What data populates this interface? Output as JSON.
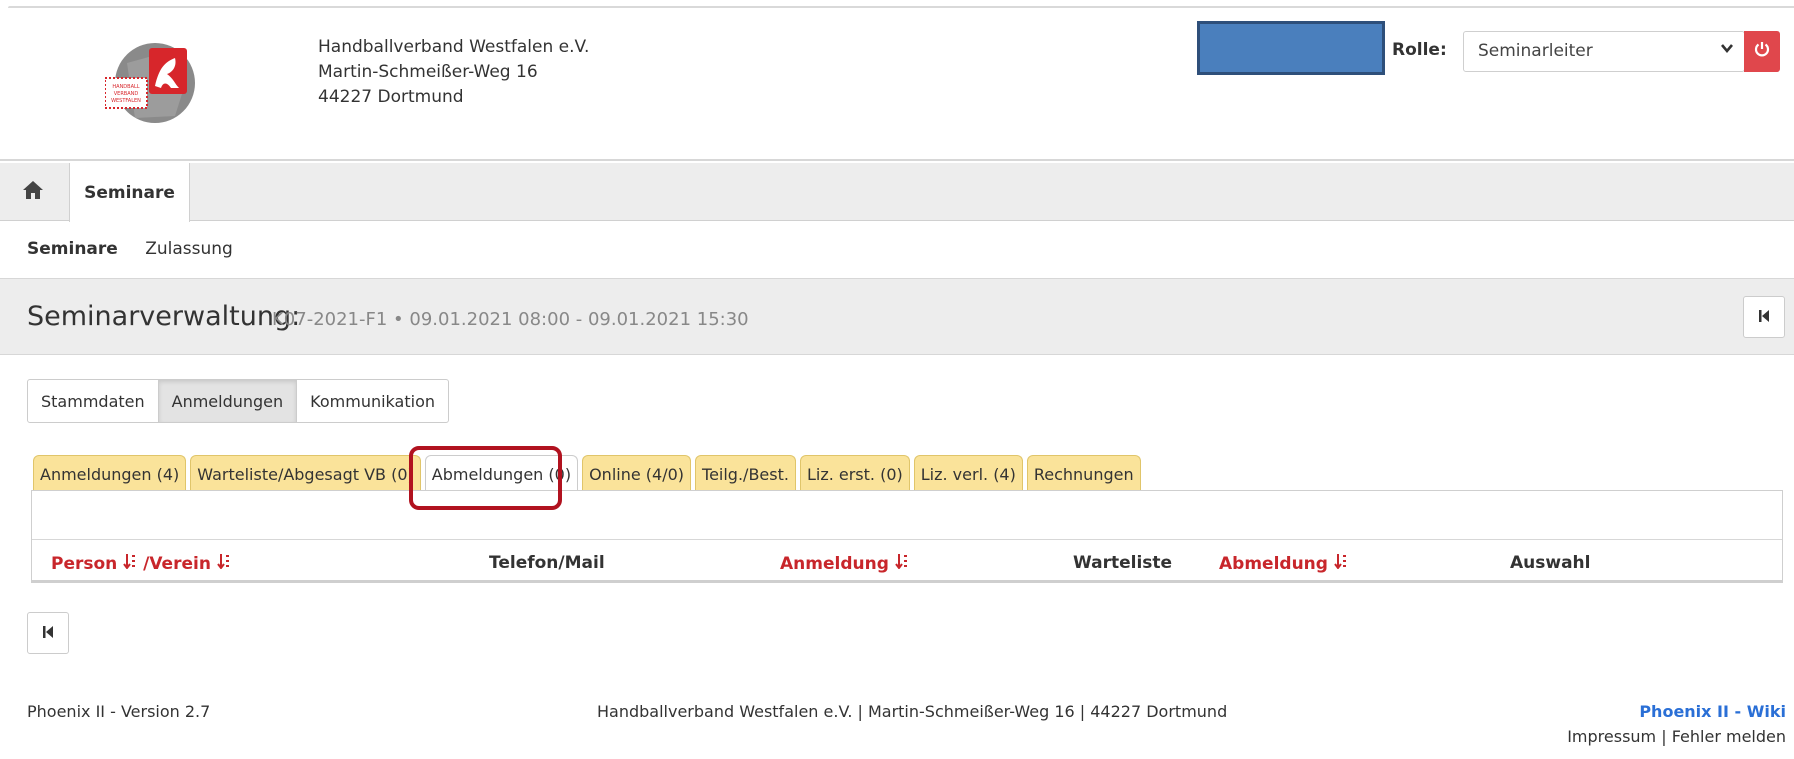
{
  "header": {
    "address_lines": [
      "Handballverband Westfalen e.V.",
      "Martin-Schmeißer-Weg 16",
      "44227 Dortmund"
    ],
    "role_label": "Rolle:",
    "role_value": "Seminarleiter",
    "logo_text": [
      "HANDBALL",
      "VERBAND",
      "WESTFALEN"
    ]
  },
  "nav": {
    "home_icon": "home-icon",
    "active_tab": "Seminare"
  },
  "subnav": {
    "items": [
      "Seminare",
      "Zulassung"
    ]
  },
  "page": {
    "title": "Seminarverwaltung:",
    "subtitle": "K07-2021-F1 • 09.01.2021 08:00 - 09.01.2021 15:30"
  },
  "main_tabs": [
    "Stammdaten",
    "Anmeldungen",
    "Kommunikation"
  ],
  "sub_tabs": [
    "Anmeldungen (4)",
    "Warteliste/Abgesagt VB (0)",
    "Abmeldungen (0)",
    "Online (4/0)",
    "Teilg./Best.",
    "Liz. erst. (0)",
    "Liz. verl. (4)",
    "Rechnungen"
  ],
  "table": {
    "col_person": "Person",
    "col_verein": "/Verein",
    "col_telefon": "Telefon/Mail",
    "col_anmeldung": "Anmeldung",
    "col_warteliste": "Warteliste",
    "col_abmeldung": "Abmeldung",
    "col_auswahl": "Auswahl"
  },
  "footer": {
    "version": "Phoenix II - Version 2.7",
    "center": "Handballverband Westfalen e.V. | Martin-Schmeißer-Weg 16 | 44227 Dortmund",
    "wiki": "Phoenix II - Wiki",
    "impressum": "Impressum",
    "divider": "|",
    "fehler": "Fehler melden"
  },
  "colors": {
    "accent_red": "#c8262b",
    "tab_yellow": "#fae39a",
    "highlight": "#b1121f",
    "link_blue": "#2a6fd6"
  }
}
